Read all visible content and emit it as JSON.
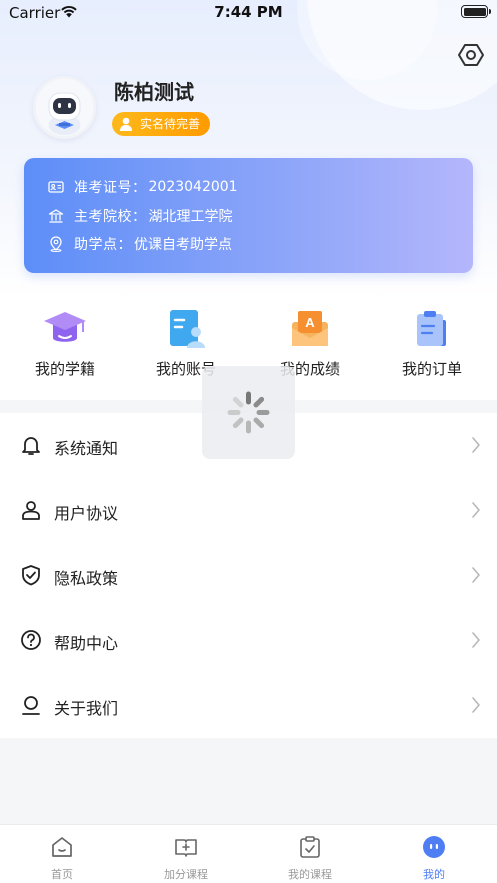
{
  "status_bar": {
    "carrier": "Carrier",
    "time": "7:44 PM"
  },
  "profile": {
    "name": "陈柏测试",
    "verify_label": "实名待完善"
  },
  "exam_card": {
    "rows": [
      {
        "label": "准考证号：",
        "value": "2023042001",
        "icon": "id-card-icon"
      },
      {
        "label": "主考院校：",
        "value": "湖北理工学院",
        "icon": "school-icon"
      },
      {
        "label": "助学点：",
        "value": "优课自考助学点",
        "icon": "location-icon"
      }
    ]
  },
  "quick_menu": {
    "items": [
      {
        "label": "我的学籍",
        "icon": "graduation-cap-icon"
      },
      {
        "label": "我的账号",
        "icon": "account-card-icon"
      },
      {
        "label": "我的成绩",
        "icon": "grade-envelope-icon"
      },
      {
        "label": "我的订单",
        "icon": "order-clipboard-icon"
      }
    ]
  },
  "settings_list": {
    "items": [
      {
        "label": "系统通知",
        "icon": "bell-icon"
      },
      {
        "label": "用户协议",
        "icon": "user-agreement-icon"
      },
      {
        "label": "隐私政策",
        "icon": "shield-check-icon"
      },
      {
        "label": "帮助中心",
        "icon": "question-circle-icon"
      },
      {
        "label": "关于我们",
        "icon": "about-us-icon"
      }
    ]
  },
  "tab_bar": {
    "tabs": [
      {
        "label": "首页",
        "icon": "home-icon",
        "active": false
      },
      {
        "label": "加分课程",
        "icon": "add-course-icon",
        "active": false
      },
      {
        "label": "我的课程",
        "icon": "my-course-icon",
        "active": false
      },
      {
        "label": "我的",
        "icon": "mine-icon",
        "active": true
      }
    ]
  },
  "colors": {
    "accent": "#4f7df4",
    "badge": "#ff9b00",
    "card_start": "#5d8ef8",
    "card_end": "#b4b6fb"
  }
}
